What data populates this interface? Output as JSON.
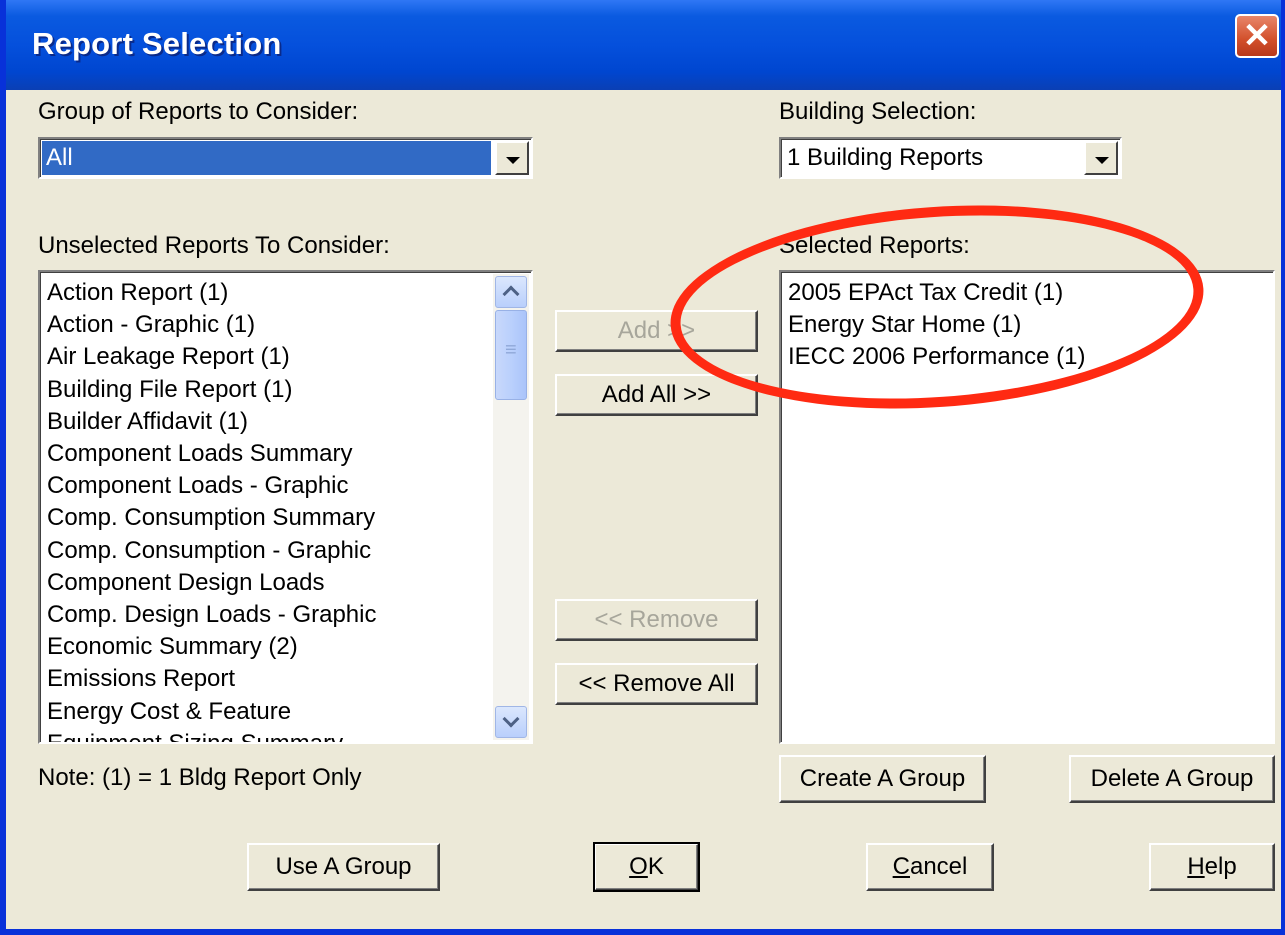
{
  "window": {
    "title": "Report Selection",
    "close_glyph": "✕"
  },
  "group_section": {
    "label": "Group of Reports to Consider:",
    "selected": "All"
  },
  "building_section": {
    "label": "Building Selection:",
    "selected": "1 Building Reports"
  },
  "unselected": {
    "label": "Unselected Reports To Consider:",
    "items": [
      "Action Report (1)",
      "Action - Graphic (1)",
      "Air Leakage Report (1)",
      "Building File Report (1)",
      "Builder Affidavit (1)",
      "Component Loads Summary",
      "Component Loads - Graphic",
      "Comp. Consumption Summary",
      "Comp. Consumption - Graphic",
      "Component Design Loads",
      "Comp. Design Loads - Graphic",
      "Economic Summary (2)",
      "Emissions Report",
      "Energy Cost & Feature",
      "Equipment Sizing Summary"
    ]
  },
  "selected": {
    "label": "Selected Reports:",
    "items": [
      "2005 EPAct Tax Credit (1)",
      "Energy Star Home (1)",
      "IECC 2006 Performance (1)"
    ]
  },
  "buttons": {
    "add": "Add >>",
    "add_all": "Add All >>",
    "remove": "<< Remove",
    "remove_all": "<< Remove All",
    "create_group": "Create A Group",
    "delete_group": "Delete A Group",
    "use_group": "Use A Group",
    "ok_mnemonic": "O",
    "ok_rest": "K",
    "cancel_mnemonic": "C",
    "cancel_rest": "ancel",
    "help_mnemonic": "H",
    "help_rest": "elp"
  },
  "note": "Note: (1) = 1 Bldg Report Only",
  "annotation": {
    "color": "#ff2a12",
    "shape": "oval highlight around selected reports"
  }
}
